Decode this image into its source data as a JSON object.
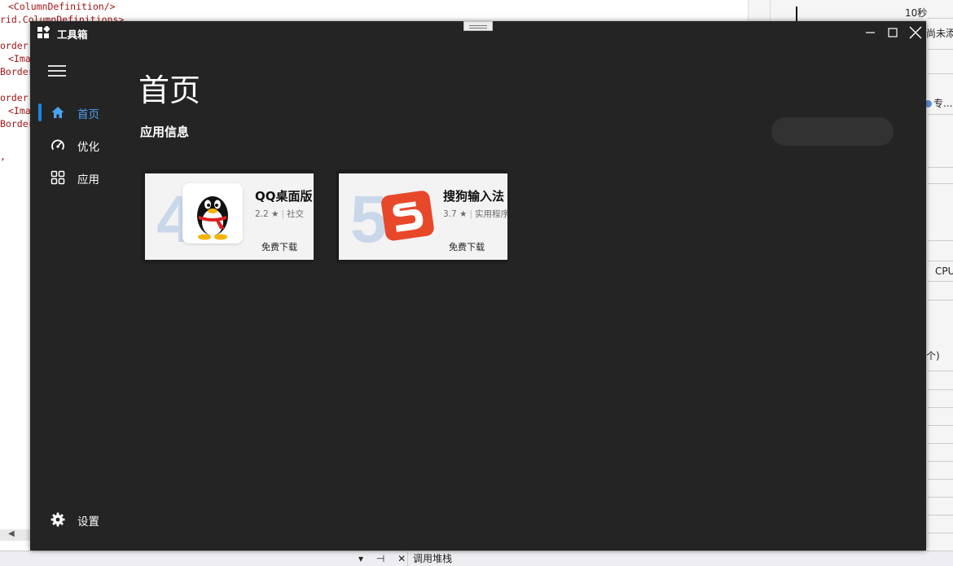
{
  "background": {
    "code_lines": [
      "<ColumnDefinition/>",
      "rid.ColumnDefinitions>",
      "order",
      "<Ima",
      "Border",
      "order",
      "<Ima",
      "Border",
      ","
    ],
    "right_panel": {
      "top_text": "10秒",
      "add_text": "尚未添加",
      "dot_label": "专...",
      "cpu_label": "CPU",
      "count_text": "个)"
    },
    "bottom": {
      "tools": "▾ ⊣ ✕",
      "tab_label": "调用堆栈"
    }
  },
  "window": {
    "title": "工具箱",
    "controls": {
      "minimize": "minimize-icon",
      "maximize": "maximize-icon",
      "close": "close-icon"
    }
  },
  "nav": {
    "items": [
      {
        "label": "首页",
        "icon": "home-icon",
        "active": true
      },
      {
        "label": "优化",
        "icon": "gauge-icon",
        "active": false
      },
      {
        "label": "应用",
        "icon": "apps-grid-icon",
        "active": false
      }
    ],
    "settings_label": "设置",
    "accent_color": "#1e86e0"
  },
  "main": {
    "page_title": "首页",
    "section_title": "应用信息",
    "cards": [
      {
        "rank": "4",
        "name": "QQ桌面版",
        "rating": "2.2 ★",
        "category": "社交",
        "action": "免费下载",
        "logo": "qq-penguin-logo"
      },
      {
        "rank": "5",
        "name": "搜狗输入法",
        "rating": "3.7 ★",
        "category": "实用程序",
        "action": "免费下载",
        "logo": "sogou-logo"
      }
    ]
  }
}
